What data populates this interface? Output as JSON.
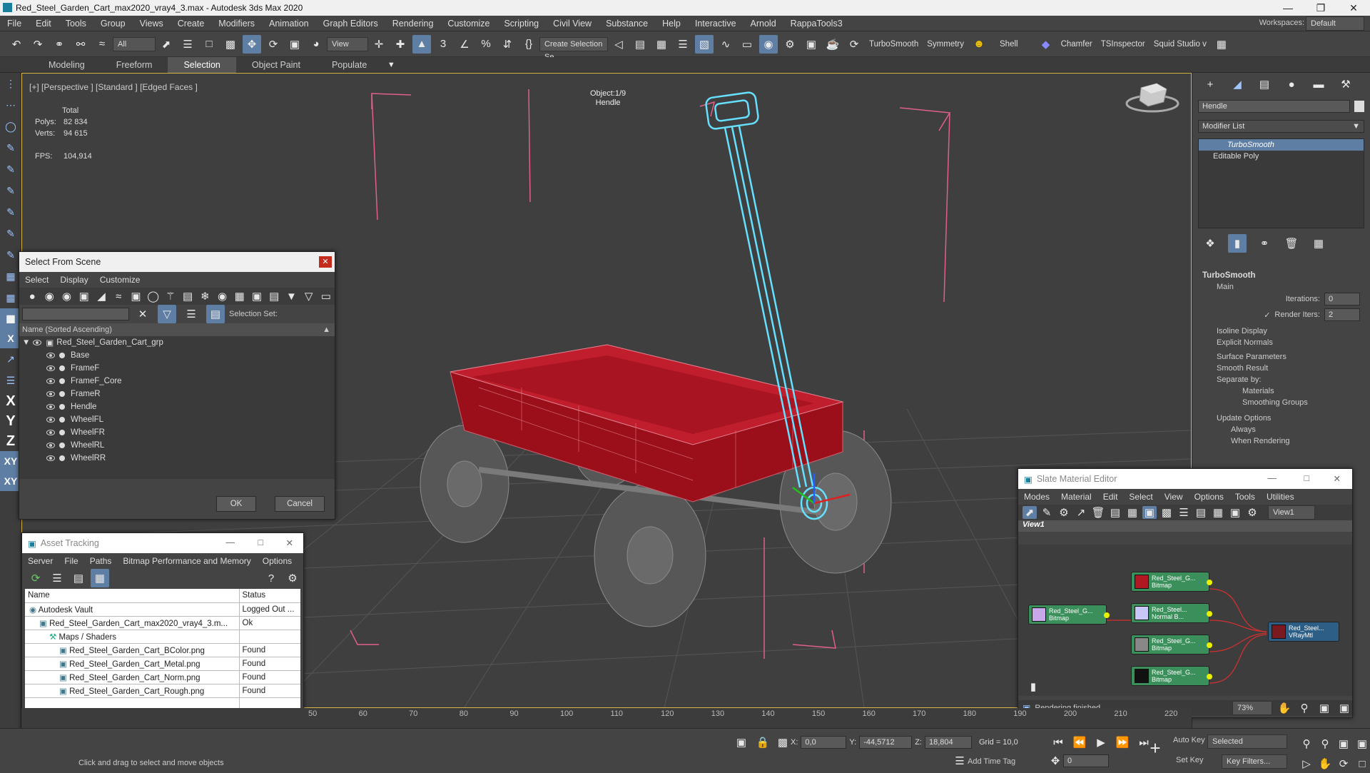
{
  "window": {
    "title": "Red_Steel_Garden_Cart_max2020_vray4_3.max - Autodesk 3ds Max 2020"
  },
  "menu": [
    "File",
    "Edit",
    "Tools",
    "Group",
    "Views",
    "Create",
    "Modifiers",
    "Animation",
    "Graph Editors",
    "Rendering",
    "Customize",
    "Scripting",
    "Civil View",
    "Substance",
    "Help",
    "Interactive",
    "Arnold",
    "RappaTools3"
  ],
  "workspace": {
    "label": "Workspaces:",
    "value": "Default"
  },
  "toolbar": {
    "filter_value": "All",
    "refcoord_value": "View",
    "selset_value": "Create Selection Se",
    "labels": [
      "TurboSmooth",
      "Symmetry",
      "Shell",
      "Chamfer",
      "TSInspector",
      "Squid Studio v"
    ]
  },
  "ribbon": {
    "tabs": [
      "Modeling",
      "Freeform",
      "Selection",
      "Object Paint",
      "Populate"
    ],
    "active": "Selection"
  },
  "viewport": {
    "label": "[+] [Perspective ] [Standard ] [Edged Faces ]",
    "stats": {
      "total_label": "Total",
      "polys_label": "Polys:",
      "polys": "82 834",
      "verts_label": "Verts:",
      "verts": "94 615",
      "fps_label": "FPS:",
      "fps": "104,914"
    },
    "object_label": "Object:1/9",
    "object_name": "Hendle"
  },
  "cmdpanel": {
    "name_value": "Hendle",
    "modifier_list": "Modifier List",
    "stack": [
      "TurboSmooth",
      "Editable Poly"
    ],
    "rollout_title": "TurboSmooth",
    "main": "Main",
    "iterations_label": "Iterations:",
    "iterations": "0",
    "render_iters_label": "Render Iters:",
    "render_iters": "2",
    "isoline": "Isoline Display",
    "explicit": "Explicit Normals",
    "surface": "Surface Parameters",
    "smooth": "Smooth Result",
    "separate": "Separate by:",
    "materials": "Materials",
    "smoothing": "Smoothing Groups",
    "update": "Update Options",
    "always": "Always",
    "when_rendering": "When Rendering"
  },
  "select_from_scene": {
    "title": "Select From Scene",
    "menu": [
      "Select",
      "Display",
      "Customize"
    ],
    "selection_set_label": "Selection Set:",
    "column": "Name (Sorted Ascending)",
    "group": "Red_Steel_Garden_Cart_grp",
    "items": [
      "Base",
      "FrameF",
      "FrameF_Core",
      "FrameR",
      "Hendle",
      "WheelFL",
      "WheelFR",
      "WheelRL",
      "WheelRR"
    ],
    "ok": "OK",
    "cancel": "Cancel"
  },
  "asset_tracking": {
    "title": "Asset Tracking",
    "menu": [
      "Server",
      "File",
      "Paths",
      "Bitmap Performance and Memory",
      "Options"
    ],
    "col_name": "Name",
    "col_status": "Status",
    "rows": [
      {
        "name": "Autodesk Vault",
        "status": "Logged Out ...",
        "indent": 0
      },
      {
        "name": "Red_Steel_Garden_Cart_max2020_vray4_3.m...",
        "status": "Ok",
        "indent": 1
      },
      {
        "name": "Maps / Shaders",
        "status": "",
        "indent": 2
      },
      {
        "name": "Red_Steel_Garden_Cart_BColor.png",
        "status": "Found",
        "indent": 3
      },
      {
        "name": "Red_Steel_Garden_Cart_Metal.png",
        "status": "Found",
        "indent": 3
      },
      {
        "name": "Red_Steel_Garden_Cart_Norm.png",
        "status": "Found",
        "indent": 3
      },
      {
        "name": "Red_Steel_Garden_Cart_Rough.png",
        "status": "Found",
        "indent": 3
      }
    ]
  },
  "slate": {
    "title": "Slate Material Editor",
    "menu": [
      "Modes",
      "Material",
      "Edit",
      "Select",
      "View",
      "Options",
      "Tools",
      "Utilities"
    ],
    "view_dd": "View1",
    "tab": "View1",
    "nodes": [
      {
        "line1": "Red_Steel_G...",
        "line2": "Bitmap"
      },
      {
        "line1": "Red_Steel_G...",
        "line2": "Bitmap"
      },
      {
        "line1": "Red_Steel...",
        "line2": "Normal B..."
      },
      {
        "line1": "Red_Steel_G...",
        "line2": "Bitmap"
      },
      {
        "line1": "Red_Steel_G...",
        "line2": "Bitmap"
      },
      {
        "line1": "Red_Steel...",
        "line2": "VRayMtl"
      }
    ],
    "status": "Rendering finished",
    "zoom": "73%"
  },
  "timeline": {
    "ticks": [
      "50",
      "60",
      "70",
      "80",
      "90",
      "100",
      "110",
      "120",
      "130",
      "140",
      "150",
      "160",
      "170",
      "180",
      "190",
      "200",
      "210",
      "220"
    ]
  },
  "statusbar": {
    "prompt": "Click and drag to select and move objects",
    "x_label": "X:",
    "x": "0,0",
    "y_label": "Y:",
    "y": "-44,5712",
    "z_label": "Z:",
    "z": "18,804",
    "grid": "Grid = 10,0",
    "add_time_tag": "Add Time Tag",
    "auto_key": "Auto Key",
    "set_key": "Set Key",
    "selected": "Selected",
    "key_filters": "Key Filters...",
    "frame": "0"
  },
  "colors": {
    "accent": "#5f7ea3",
    "viewport_border": "#d9b84a",
    "wire_selected": "#66e0ff",
    "cart_red": "#b01822",
    "bbox_pink": "#e0608a"
  }
}
